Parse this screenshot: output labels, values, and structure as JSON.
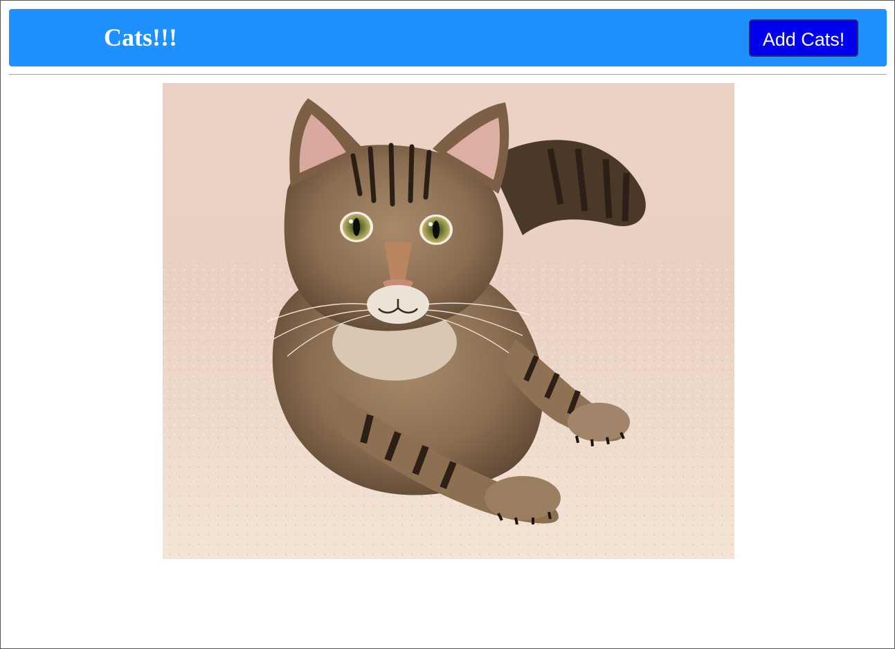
{
  "app": {
    "title": "Cats!!!"
  },
  "toolbar": {
    "add_label": "Add Cats!"
  },
  "colors": {
    "header_bg": "#1e90ff",
    "button_bg": "#0000ee",
    "text": "#ffffff"
  },
  "photo": {
    "subject": "tabby cat lying on carpet"
  }
}
